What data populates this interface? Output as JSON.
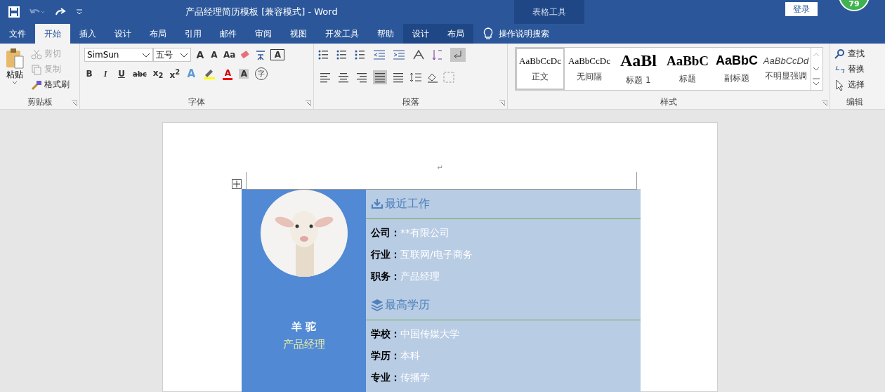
{
  "window": {
    "title": "产品经理简历模板 [兼容模式]  -  Word",
    "context_group": "表格工具",
    "login": "登录",
    "badge": "79"
  },
  "tabs": [
    {
      "label": "文件",
      "selected": false,
      "kind": "normal"
    },
    {
      "label": "开始",
      "selected": true,
      "kind": "normal"
    },
    {
      "label": "插入",
      "selected": false,
      "kind": "normal"
    },
    {
      "label": "设计",
      "selected": false,
      "kind": "normal"
    },
    {
      "label": "布局",
      "selected": false,
      "kind": "normal"
    },
    {
      "label": "引用",
      "selected": false,
      "kind": "normal"
    },
    {
      "label": "邮件",
      "selected": false,
      "kind": "normal"
    },
    {
      "label": "审阅",
      "selected": false,
      "kind": "normal"
    },
    {
      "label": "视图",
      "selected": false,
      "kind": "normal"
    },
    {
      "label": "开发工具",
      "selected": false,
      "kind": "normal"
    },
    {
      "label": "帮助",
      "selected": false,
      "kind": "normal"
    },
    {
      "label": "设计",
      "selected": false,
      "kind": "context"
    },
    {
      "label": "布局",
      "selected": false,
      "kind": "context"
    }
  ],
  "tell_me": "操作说明搜索",
  "clipboard": {
    "label": "剪贴板",
    "paste": "粘贴",
    "items": [
      {
        "label": "剪切",
        "disabled": true
      },
      {
        "label": "复制",
        "disabled": true
      },
      {
        "label": "格式刷",
        "disabled": false
      }
    ]
  },
  "font": {
    "label": "字体",
    "name": "SimSun",
    "size": "五号",
    "grow": "A",
    "shrink": "A",
    "case": "Aa",
    "border_char": "A",
    "format": [
      "B",
      "I",
      "U",
      "abc"
    ],
    "sub": "x",
    "sub_mark": "2",
    "sup": "x",
    "sup_mark": "2",
    "effects": "A",
    "font_color_button": "A",
    "shade": "A",
    "enclose": "字"
  },
  "paragraph": {
    "label": "段落",
    "align": [
      {
        "selected": false
      },
      {
        "selected": false
      },
      {
        "selected": false
      },
      {
        "selected": true
      },
      {
        "selected": false
      }
    ]
  },
  "styles": {
    "label": "样式",
    "items": [
      {
        "sample": "AaBbCcDc",
        "name": "正文",
        "kind": "body",
        "selected": true
      },
      {
        "sample": "AaBbCcDc",
        "name": "无间隔",
        "kind": "body",
        "selected": false
      },
      {
        "sample": "AaBl",
        "name": "标题 1",
        "kind": "h1",
        "selected": false
      },
      {
        "sample": "AaBbC",
        "name": "标题",
        "kind": "h2",
        "selected": false
      },
      {
        "sample": "AaBbC",
        "name": "副标题",
        "kind": "sub",
        "selected": false
      },
      {
        "sample": "AaBbCcDd",
        "name": "不明显强调",
        "kind": "em",
        "selected": false
      }
    ]
  },
  "editing": {
    "label": "编辑",
    "items": [
      "查找",
      "替换",
      "选择"
    ]
  },
  "header_mark": "↵",
  "resume": {
    "name": "羊 驼",
    "role": "产品经理",
    "sections": [
      {
        "heading": "最近工作",
        "kind": "work",
        "rows": [
          {
            "label": "公司：",
            "value": "**有限公司"
          },
          {
            "label": "行业：",
            "value": "互联网/电子商务"
          },
          {
            "label": "职务：",
            "value": "产品经理"
          }
        ]
      },
      {
        "heading": "最高学历",
        "kind": "education",
        "rows": [
          {
            "label": "学校：",
            "value": "中国传媒大学"
          },
          {
            "label": "学历：",
            "value": "本科"
          },
          {
            "label": "专业：",
            "value": "传播学"
          }
        ]
      }
    ]
  }
}
